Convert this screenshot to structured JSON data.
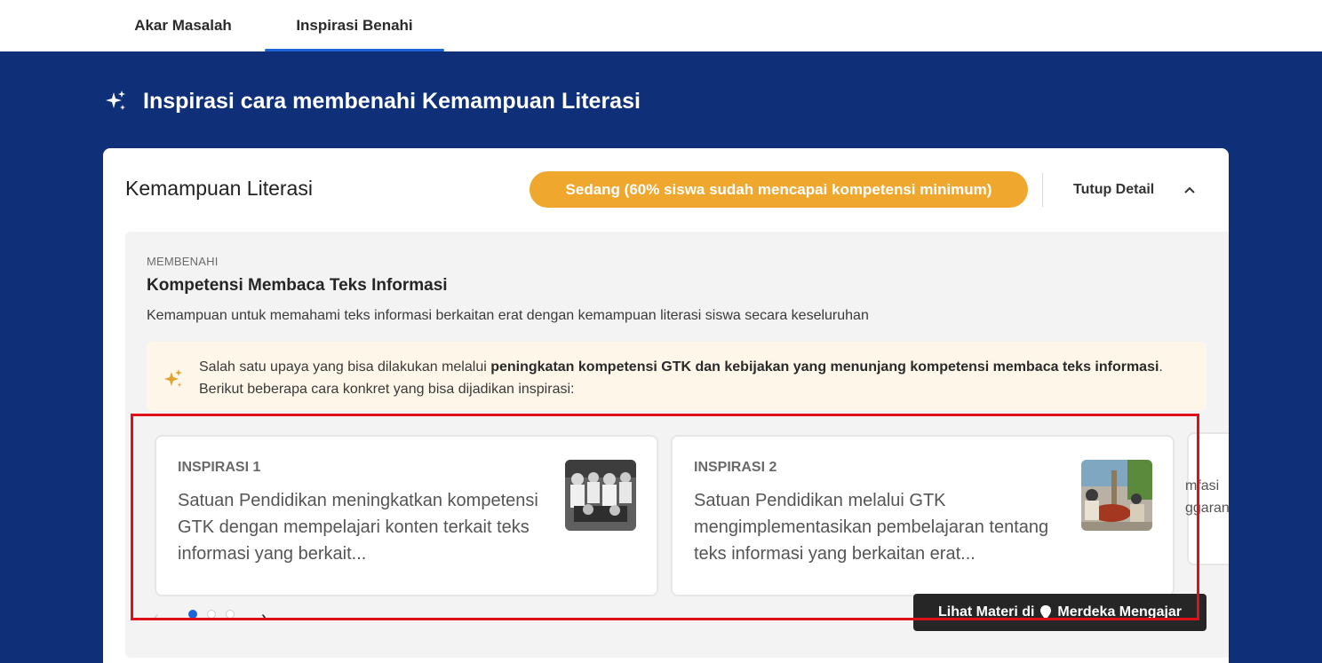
{
  "tabs": [
    {
      "label": "Akar Masalah",
      "active": false
    },
    {
      "label": "Inspirasi Benahi",
      "active": true
    }
  ],
  "page": {
    "title": "Inspirasi cara membenahi Kemampuan Literasi",
    "icon": "sparkle-icon"
  },
  "card": {
    "title": "Kemampuan Literasi",
    "badge": "Sedang (60% siswa sudah mencapai kompetensi minimum)",
    "toggle_label": "Tutup Detail",
    "toggle_icon": "chevron-up-icon"
  },
  "section": {
    "eyebrow": "MEMBENAHI",
    "title": "Kompetensi Membaca Teks Informasi",
    "description": "Kemampuan untuk memahami teks informasi berkaitan erat dengan kemampuan literasi siswa secara keseluruhan"
  },
  "notice": {
    "prefix": "Salah satu upaya yang bisa dilakukan melalui ",
    "bold": "peningkatan kompetensi GTK dan kebijakan yang menunjang kompetensi membaca teks informasi",
    "suffix": ". Berikut beberapa cara konkret yang bisa dijadikan inspirasi:",
    "icon": "sparkle-icon"
  },
  "inspirations": [
    {
      "label": "INSPIRASI 1",
      "text": "Satuan Pendidikan meningkatkan kompetensi GTK dengan mempelajari konten terkait teks informasi yang berkait..."
    },
    {
      "label": "INSPIRASI 2",
      "text": "Satuan Pendidikan melalui GTK mengimplementasikan pembelajaran tentang teks informasi yang berkaitan erat..."
    },
    {
      "line1": "mfasi",
      "line2": "ggaran"
    }
  ],
  "carousel": {
    "total_pages": 3,
    "active_page": 1,
    "prev_icon": "chevron-left-icon",
    "next_icon": "chevron-right-icon"
  },
  "cta": {
    "label_before": "Lihat Materi di",
    "label_after": "Merdeka Mengajar",
    "icon": "merdeka-mengajar-logo-icon"
  },
  "colors": {
    "primary_blue": "#0f3079",
    "accent_blue": "#1d63d9",
    "badge_orange": "#f0a72e",
    "highlight_red": "#e0101a"
  }
}
